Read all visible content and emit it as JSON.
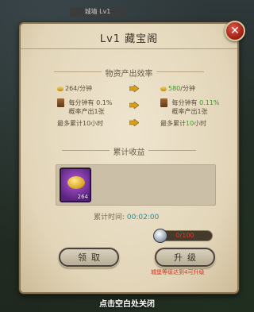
{
  "top_banner": "城墙 Lv1",
  "panel": {
    "title": "Lv1  藏宝阁"
  },
  "output": {
    "header": "物资产出效率",
    "current": {
      "rate": "264/分钟",
      "chance": "每分钟有 0.1%",
      "chance2": "概率产出1张",
      "max": "最多累计10小时"
    },
    "next": {
      "rate": "580",
      "rate_unit": "/分钟",
      "chance_prefix": "每分钟有 ",
      "chance": "0.11%",
      "chance2": "概率产出1张",
      "max_prefix": "最多累计",
      "max_val": "10",
      "max_unit": "小时"
    }
  },
  "gain": {
    "header": "累计收益",
    "item_count": "264"
  },
  "timer": {
    "label": "累计时间:",
    "value": "00:02:00"
  },
  "upgrade": {
    "progress_text": "0/100",
    "progress_fraction": 0.0,
    "requirement": "城堡等级达到4可升级"
  },
  "buttons": {
    "collect": "领取",
    "upgrade": "升级"
  },
  "footer": "点击空白处关闭",
  "colors": {
    "green": "#3b9a24",
    "red": "#d0321f",
    "purple_slot": "#8a3fb0"
  }
}
